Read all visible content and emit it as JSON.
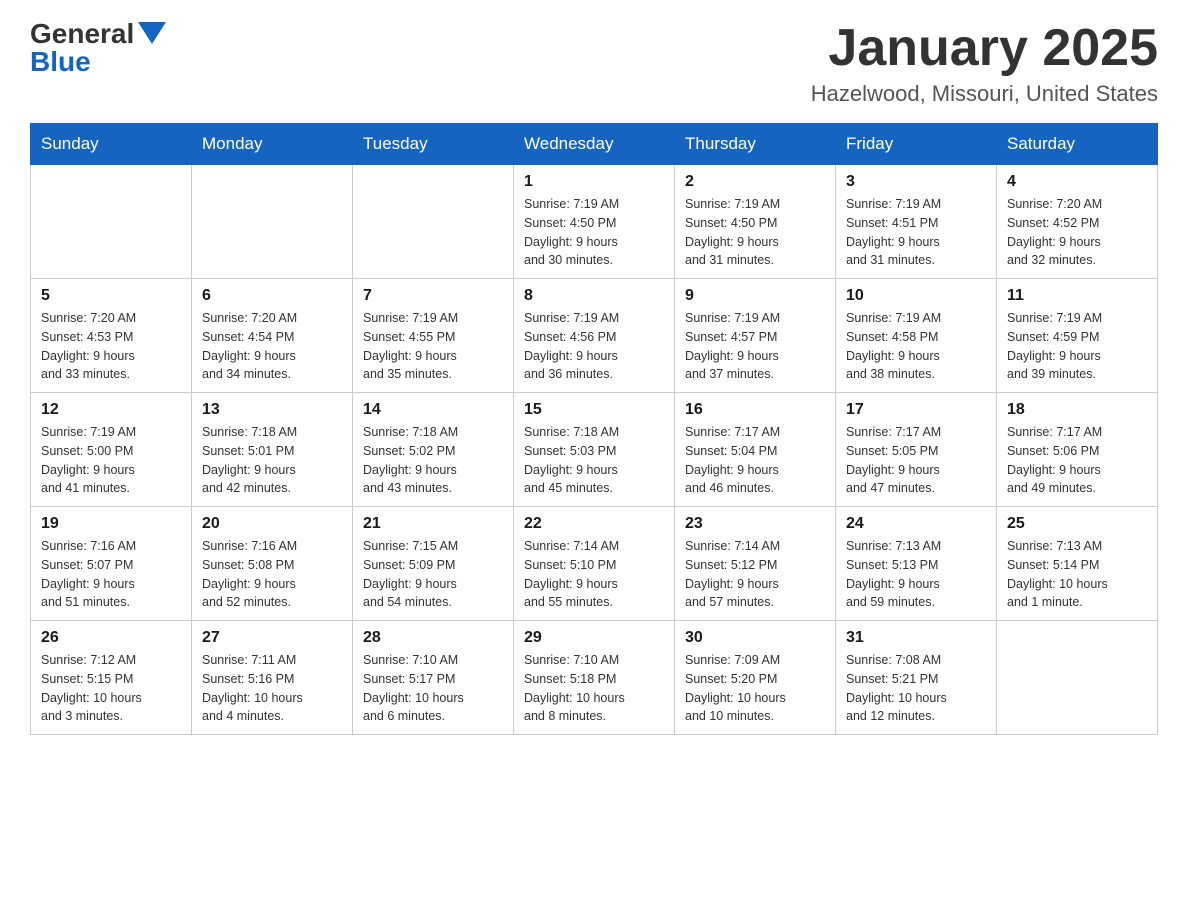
{
  "header": {
    "logo_general": "General",
    "logo_blue": "Blue",
    "title": "January 2025",
    "location": "Hazelwood, Missouri, United States"
  },
  "days_of_week": [
    "Sunday",
    "Monday",
    "Tuesday",
    "Wednesday",
    "Thursday",
    "Friday",
    "Saturday"
  ],
  "weeks": [
    [
      {
        "day": "",
        "info": ""
      },
      {
        "day": "",
        "info": ""
      },
      {
        "day": "",
        "info": ""
      },
      {
        "day": "1",
        "info": "Sunrise: 7:19 AM\nSunset: 4:50 PM\nDaylight: 9 hours\nand 30 minutes."
      },
      {
        "day": "2",
        "info": "Sunrise: 7:19 AM\nSunset: 4:50 PM\nDaylight: 9 hours\nand 31 minutes."
      },
      {
        "day": "3",
        "info": "Sunrise: 7:19 AM\nSunset: 4:51 PM\nDaylight: 9 hours\nand 31 minutes."
      },
      {
        "day": "4",
        "info": "Sunrise: 7:20 AM\nSunset: 4:52 PM\nDaylight: 9 hours\nand 32 minutes."
      }
    ],
    [
      {
        "day": "5",
        "info": "Sunrise: 7:20 AM\nSunset: 4:53 PM\nDaylight: 9 hours\nand 33 minutes."
      },
      {
        "day": "6",
        "info": "Sunrise: 7:20 AM\nSunset: 4:54 PM\nDaylight: 9 hours\nand 34 minutes."
      },
      {
        "day": "7",
        "info": "Sunrise: 7:19 AM\nSunset: 4:55 PM\nDaylight: 9 hours\nand 35 minutes."
      },
      {
        "day": "8",
        "info": "Sunrise: 7:19 AM\nSunset: 4:56 PM\nDaylight: 9 hours\nand 36 minutes."
      },
      {
        "day": "9",
        "info": "Sunrise: 7:19 AM\nSunset: 4:57 PM\nDaylight: 9 hours\nand 37 minutes."
      },
      {
        "day": "10",
        "info": "Sunrise: 7:19 AM\nSunset: 4:58 PM\nDaylight: 9 hours\nand 38 minutes."
      },
      {
        "day": "11",
        "info": "Sunrise: 7:19 AM\nSunset: 4:59 PM\nDaylight: 9 hours\nand 39 minutes."
      }
    ],
    [
      {
        "day": "12",
        "info": "Sunrise: 7:19 AM\nSunset: 5:00 PM\nDaylight: 9 hours\nand 41 minutes."
      },
      {
        "day": "13",
        "info": "Sunrise: 7:18 AM\nSunset: 5:01 PM\nDaylight: 9 hours\nand 42 minutes."
      },
      {
        "day": "14",
        "info": "Sunrise: 7:18 AM\nSunset: 5:02 PM\nDaylight: 9 hours\nand 43 minutes."
      },
      {
        "day": "15",
        "info": "Sunrise: 7:18 AM\nSunset: 5:03 PM\nDaylight: 9 hours\nand 45 minutes."
      },
      {
        "day": "16",
        "info": "Sunrise: 7:17 AM\nSunset: 5:04 PM\nDaylight: 9 hours\nand 46 minutes."
      },
      {
        "day": "17",
        "info": "Sunrise: 7:17 AM\nSunset: 5:05 PM\nDaylight: 9 hours\nand 47 minutes."
      },
      {
        "day": "18",
        "info": "Sunrise: 7:17 AM\nSunset: 5:06 PM\nDaylight: 9 hours\nand 49 minutes."
      }
    ],
    [
      {
        "day": "19",
        "info": "Sunrise: 7:16 AM\nSunset: 5:07 PM\nDaylight: 9 hours\nand 51 minutes."
      },
      {
        "day": "20",
        "info": "Sunrise: 7:16 AM\nSunset: 5:08 PM\nDaylight: 9 hours\nand 52 minutes."
      },
      {
        "day": "21",
        "info": "Sunrise: 7:15 AM\nSunset: 5:09 PM\nDaylight: 9 hours\nand 54 minutes."
      },
      {
        "day": "22",
        "info": "Sunrise: 7:14 AM\nSunset: 5:10 PM\nDaylight: 9 hours\nand 55 minutes."
      },
      {
        "day": "23",
        "info": "Sunrise: 7:14 AM\nSunset: 5:12 PM\nDaylight: 9 hours\nand 57 minutes."
      },
      {
        "day": "24",
        "info": "Sunrise: 7:13 AM\nSunset: 5:13 PM\nDaylight: 9 hours\nand 59 minutes."
      },
      {
        "day": "25",
        "info": "Sunrise: 7:13 AM\nSunset: 5:14 PM\nDaylight: 10 hours\nand 1 minute."
      }
    ],
    [
      {
        "day": "26",
        "info": "Sunrise: 7:12 AM\nSunset: 5:15 PM\nDaylight: 10 hours\nand 3 minutes."
      },
      {
        "day": "27",
        "info": "Sunrise: 7:11 AM\nSunset: 5:16 PM\nDaylight: 10 hours\nand 4 minutes."
      },
      {
        "day": "28",
        "info": "Sunrise: 7:10 AM\nSunset: 5:17 PM\nDaylight: 10 hours\nand 6 minutes."
      },
      {
        "day": "29",
        "info": "Sunrise: 7:10 AM\nSunset: 5:18 PM\nDaylight: 10 hours\nand 8 minutes."
      },
      {
        "day": "30",
        "info": "Sunrise: 7:09 AM\nSunset: 5:20 PM\nDaylight: 10 hours\nand 10 minutes."
      },
      {
        "day": "31",
        "info": "Sunrise: 7:08 AM\nSunset: 5:21 PM\nDaylight: 10 hours\nand 12 minutes."
      },
      {
        "day": "",
        "info": ""
      }
    ]
  ]
}
